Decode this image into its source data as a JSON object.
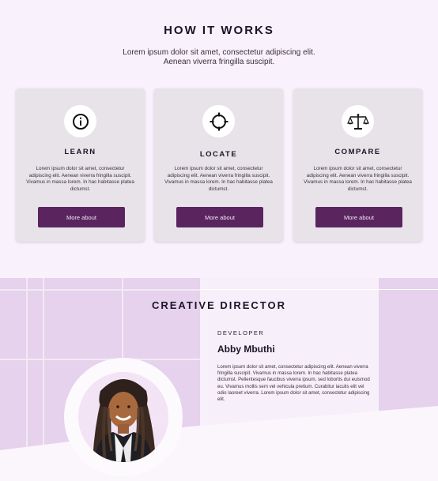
{
  "how_it_works": {
    "title": "HOW IT WORKS",
    "lead_line1": "Lorem ipsum dolor sit amet, consectetur adipiscing elit.",
    "lead_line2": "Aenean viverra fringilla suscipit.",
    "cards": [
      {
        "icon": "info-icon",
        "title": "LEARN",
        "text": "Lorem ipsum dolor sit amet, consectetur adipiscing elit. Aenean viverra fringilla suscipit. Vivamus in massa lorem. In hac habitasse platea dictumst.",
        "button": "More about"
      },
      {
        "icon": "crosshair-icon",
        "title": "LOCATE",
        "text": "Lorem ipsum dolor sit amet, consectetur adipiscing elit. Aenean viverra fringilla suscipit. Vivamus in massa lorem. In hac habitasse platea dictumst.",
        "button": "More about"
      },
      {
        "icon": "scale-icon",
        "title": "COMPARE",
        "text": "Lorem ipsum dolor sit amet, consectetur adipiscing elit. Aenean viverra fringilla suscipit. Vivamus in massa lorem. In hac habitasse platea dictumst.",
        "button": "More about"
      }
    ]
  },
  "creative_director": {
    "title": "CREATIVE DIRECTOR",
    "role": "DEVELOPER",
    "name": "Abby Mbuthi",
    "bio": "Lorem ipsum dolor sit amet, consectetur adipiscing elit. Aenean viverra fringilla suscipit. Vivamus in massa lorem. In hac habitasse platea dictumst. Pellentesque faucibus viverra ipsum, sed lobortis dui euismod eu. Vivamus mollis sem vel vehicula pretium. Curabitur iaculis elit vel odio laoreet viverra. Lorem ipsum dolor sit amet, consectetur adipiscing elit."
  },
  "colors": {
    "accent": "#5a245f",
    "page_background": "#f9f1fc",
    "card_background": "#e8e3e8",
    "section_background": "#e6d2ec"
  }
}
